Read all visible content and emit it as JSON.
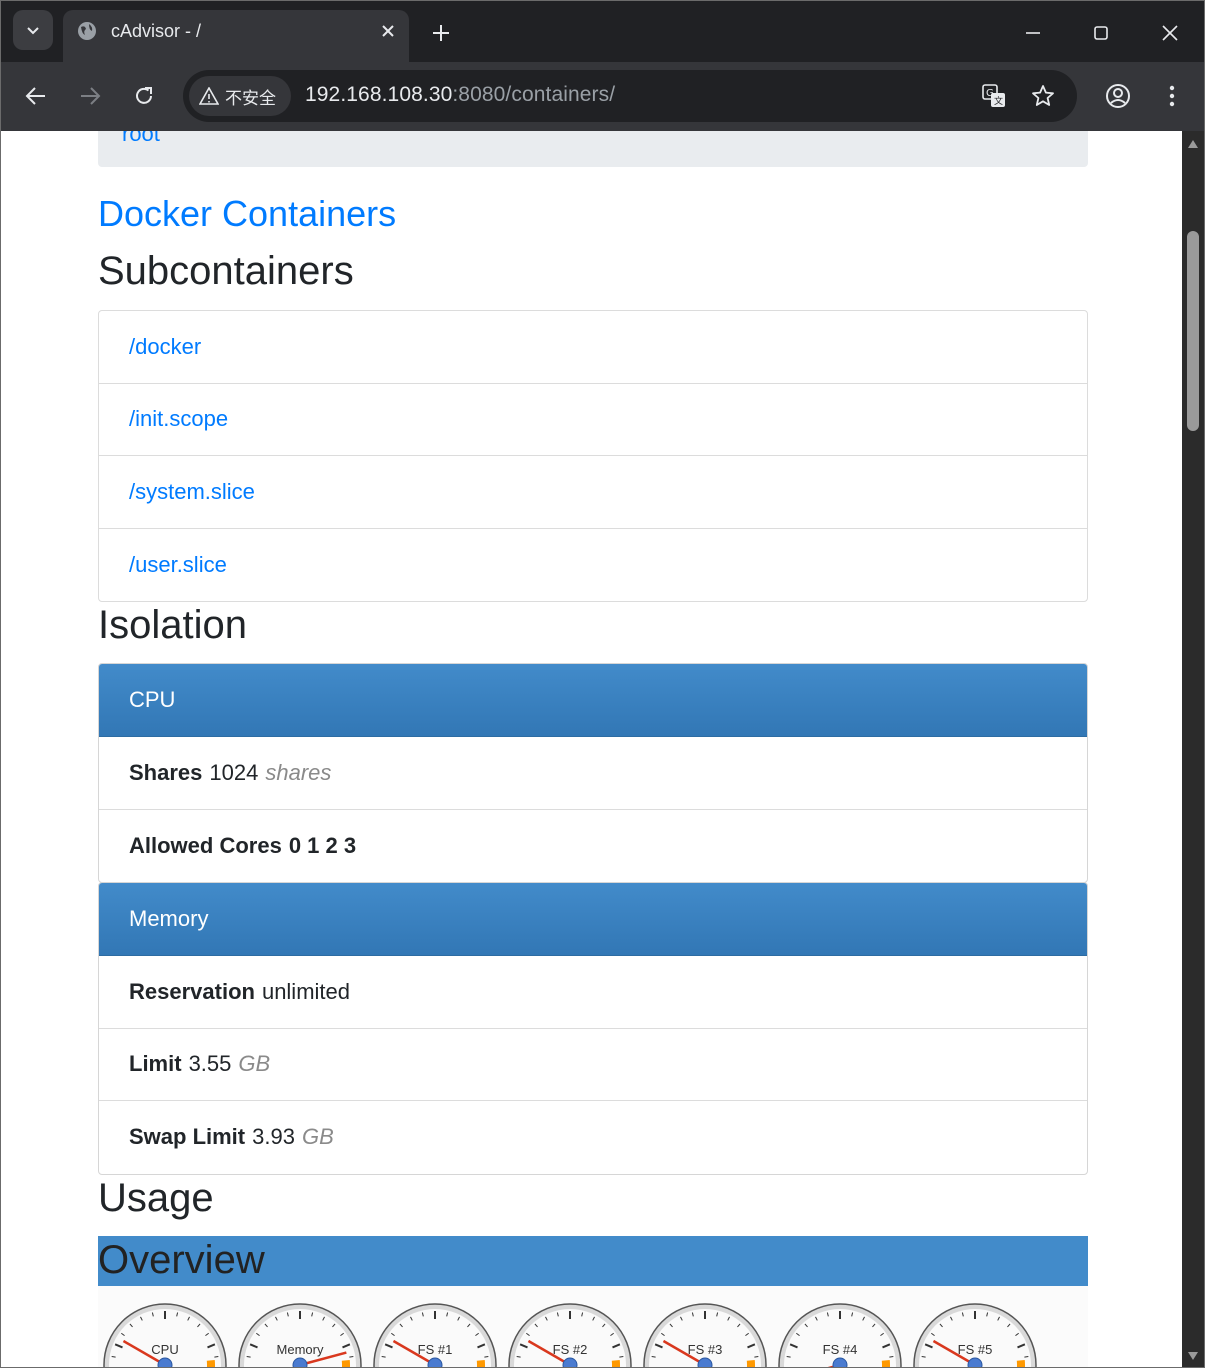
{
  "browser": {
    "tab_title": "cAdvisor - /",
    "security_label": "不安全",
    "url_host": "192.168.108.30",
    "url_rest": ":8080/containers/"
  },
  "page": {
    "breadcrumb": "root",
    "docker_link": "Docker Containers",
    "subcontainers_heading": "Subcontainers",
    "subcontainers": [
      "/docker",
      "/init.scope",
      "/system.slice",
      "/user.slice"
    ],
    "isolation_heading": "Isolation",
    "cpu": {
      "heading": "CPU",
      "shares_label": "Shares",
      "shares_value": "1024",
      "shares_unit": "shares",
      "cores_label": "Allowed Cores",
      "cores_value": "0 1 2 3"
    },
    "memory": {
      "heading": "Memory",
      "reservation_label": "Reservation",
      "reservation_value": "unlimited",
      "limit_label": "Limit",
      "limit_value": "3.55",
      "limit_unit": "GB",
      "swap_label": "Swap Limit",
      "swap_value": "3.93",
      "swap_unit": "GB"
    },
    "usage_heading": "Usage",
    "overview_heading": "Overview",
    "gauges": [
      "CPU",
      "Memory",
      "FS #1",
      "FS #2",
      "FS #3",
      "FS #4",
      "FS #5"
    ]
  },
  "colors": {
    "link": "#007bff",
    "panel_heading": "#428bca",
    "chrome_dark": "#202124",
    "chrome_toolbar": "#35363a"
  }
}
